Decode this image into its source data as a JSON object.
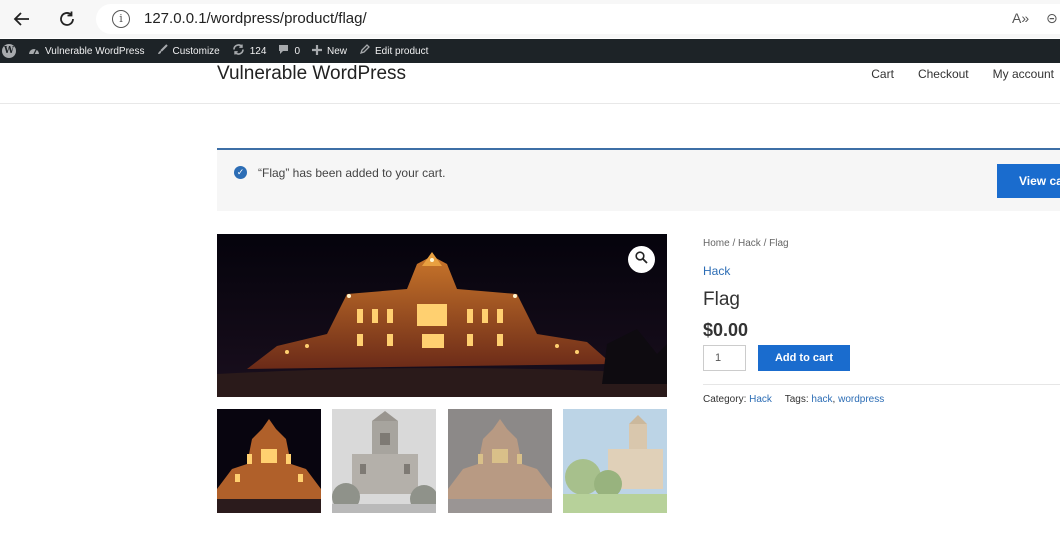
{
  "browser": {
    "url": "127.0.0.1/wordpress/product/flag/",
    "info_glyph": "i",
    "read_aloud_glyph": "A»",
    "zoom_glyph": "⊝"
  },
  "adminbar": {
    "site_name": "Vulnerable WordPress",
    "customize": "Customize",
    "updates_count": "124",
    "comments_count": "0",
    "new_label": "New",
    "edit_label": "Edit product"
  },
  "header": {
    "site_title": "Vulnerable WordPress",
    "menu": [
      "Cart",
      "Checkout",
      "My account"
    ]
  },
  "notice": {
    "message": "“Flag” has been added to your cart.",
    "button_label": "View cart"
  },
  "product": {
    "breadcrumb": "Home / Hack / Flag",
    "category_link": "Hack",
    "title": "Flag",
    "price": "$0.00",
    "quantity": "1",
    "add_to_cart_label": "Add to cart",
    "category_label": "Category:",
    "category_value": "Hack",
    "tags_label": "Tags:",
    "tags": [
      "hack",
      "wordpress"
    ]
  },
  "colors": {
    "accent": "#1a6cce",
    "admin_bar": "#1d2327",
    "notice_border": "#3d6fa6"
  }
}
